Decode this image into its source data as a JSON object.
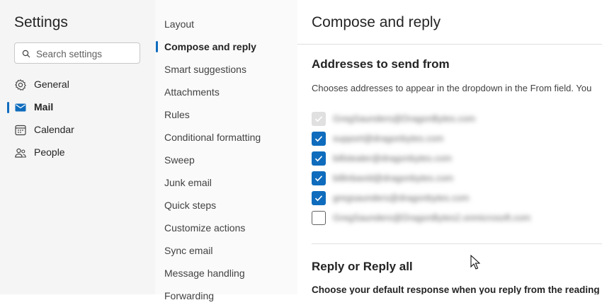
{
  "settings": {
    "title": "Settings",
    "search_placeholder": "Search settings",
    "nav": [
      {
        "label": "General",
        "icon": "gear-icon"
      },
      {
        "label": "Mail",
        "icon": "mail-icon",
        "active": true
      },
      {
        "label": "Calendar",
        "icon": "calendar-icon"
      },
      {
        "label": "People",
        "icon": "people-icon"
      }
    ]
  },
  "mail_nav": {
    "items": [
      "Layout",
      "Compose and reply",
      "Smart suggestions",
      "Attachments",
      "Rules",
      "Conditional formatting",
      "Sweep",
      "Junk email",
      "Quick steps",
      "Customize actions",
      "Sync email",
      "Message handling",
      "Forwarding"
    ],
    "active_index": 1
  },
  "content": {
    "title": "Compose and reply",
    "addresses_section_title": "Addresses to send from",
    "addresses_description": "Chooses addresses to appear in the dropdown in the From field. You",
    "addresses": [
      {
        "email": "GregSaunders@DragonBytes.com",
        "state": "checked-disabled"
      },
      {
        "email": "support@dragonbytes.com",
        "state": "checked"
      },
      {
        "email": "billstealer@dragonbytes.com",
        "state": "checked"
      },
      {
        "email": "billinbavid@dragonbytes.com",
        "state": "checked"
      },
      {
        "email": "gregsaunders@dragonbytes.com",
        "state": "checked"
      },
      {
        "email": "GregSaunders@DragonBytes2.onmicrosoft.com",
        "state": "unchecked"
      }
    ],
    "reply_section_title": "Reply or Reply all",
    "reply_description": "Choose your default response when you reply from the reading pane"
  },
  "colors": {
    "accent": "#0f6cbd",
    "nav_bg": "#f5f5f5",
    "subnav_bg": "#fafafa"
  }
}
